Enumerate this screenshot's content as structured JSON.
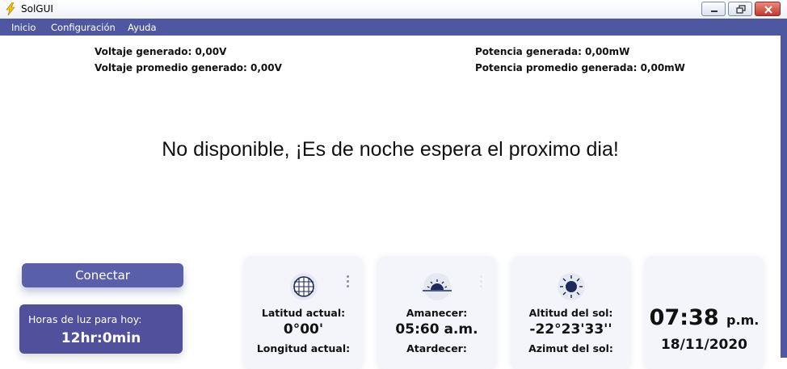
{
  "window": {
    "title": "SolGUI",
    "controls": [
      "minimize",
      "maximize",
      "close"
    ]
  },
  "menu": {
    "items": [
      "Inicio",
      "Configuración",
      "Ayuda"
    ]
  },
  "stats": {
    "voltage": "Voltaje generado: 0,00V",
    "avg_voltage": "Voltaje promedio generado: 0,00V",
    "power": "Potencia generada: 0,00mW",
    "avg_power": "Potencia promedio generada: 0,00mW"
  },
  "message": "No disponible, ¡Es de noche espera el proximo dia!",
  "connect_button": "Conectar",
  "daylight": {
    "label": "Horas de luz para hoy:",
    "value": "12hr:0min"
  },
  "cards": {
    "location": {
      "icon": "globe-icon",
      "lat_label": "Latitud actual:",
      "lat_value": "0°00'",
      "lon_label": "Longitud actual:"
    },
    "sun_times": {
      "icon": "sunrise-icon",
      "sunrise_label": "Amanecer:",
      "sunrise_value": "05:60 a.m.",
      "sunset_label": "Atardecer:"
    },
    "sun_position": {
      "icon": "sun-icon",
      "altitude_label": "Altitud del sol:",
      "altitude_value": "-22°23'33''",
      "azimuth_label": "Azimut del sol:"
    },
    "clock": {
      "time": "07:38",
      "ampm": "p.m.",
      "date": "18/11/2020"
    }
  },
  "colors": {
    "menubar": "#4e58a0",
    "connect_button": "#5a5fa9",
    "daylight_card": "#50509c",
    "card_bg": "#f4f5fa"
  }
}
